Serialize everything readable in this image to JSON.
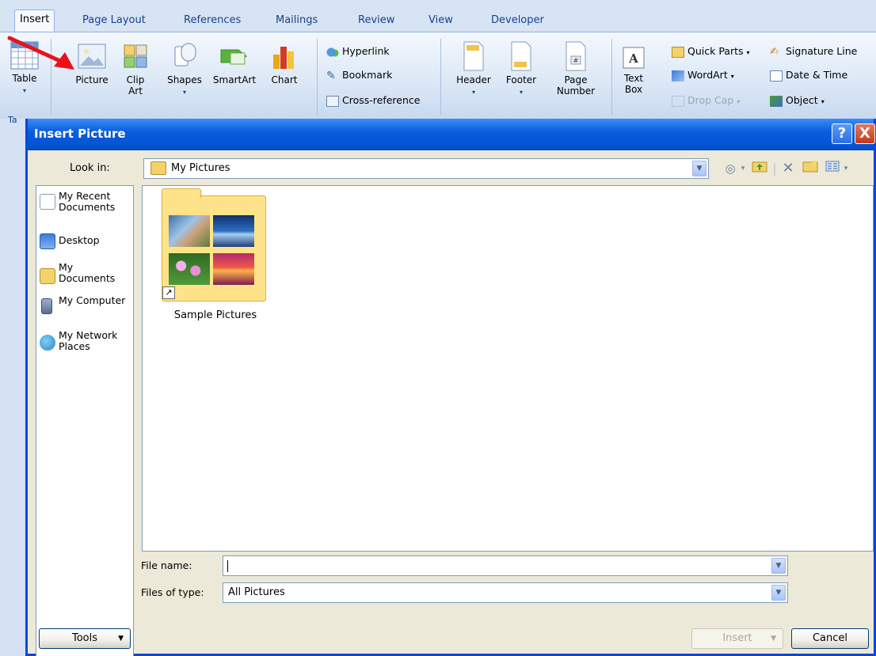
{
  "ribbon": {
    "tabs": [
      "Insert",
      "Page Layout",
      "References",
      "Mailings",
      "Review",
      "View",
      "Developer"
    ],
    "tables_button": "Table",
    "group_label": "Ta",
    "illustrations": [
      "Picture",
      "Clip\nArt",
      "Shapes",
      "SmartArt",
      "Chart"
    ],
    "links": [
      "Hyperlink",
      "Bookmark",
      "Cross-reference"
    ],
    "header_footer": [
      "Header",
      "Footer",
      "Page\nNumber"
    ],
    "text_box": "Text\nBox",
    "text_items": [
      "Quick Parts",
      "WordArt",
      "Drop Cap"
    ],
    "text_items_right": [
      "Signature Line",
      "Date & Time",
      "Object"
    ]
  },
  "dialog": {
    "title": "Insert Picture",
    "help_glyph": "?",
    "close_glyph": "X",
    "look_in_label": "Look in:",
    "look_in_value": "My Pictures",
    "places": [
      "My Recent Documents",
      "Desktop",
      "My Documents",
      "My Computer",
      "My Network Places"
    ],
    "files": [
      {
        "name": "Sample Pictures",
        "type": "folder"
      }
    ],
    "file_name_label": "File name:",
    "file_name_value": "",
    "files_of_type_label": "Files of type:",
    "files_of_type_value": "All Pictures",
    "tools_button": "Tools",
    "insert_button": "Insert",
    "cancel_button": "Cancel"
  },
  "colors": {
    "titlebar": "#0a5ee0",
    "ribbon_text": "#15428b",
    "annotation_arrow": "#e8121a"
  },
  "icons": [
    "table-icon",
    "picture-icon",
    "clip-art-icon",
    "shapes-icon",
    "smartart-icon",
    "chart-icon",
    "hyperlink-icon",
    "bookmark-icon",
    "cross-reference-icon",
    "header-icon",
    "footer-icon",
    "page-number-icon",
    "text-box-icon",
    "quick-parts-icon",
    "wordart-icon",
    "drop-cap-icon",
    "signature-line-icon",
    "date-time-icon",
    "object-icon",
    "folder-icon",
    "back-icon",
    "up-folder-icon",
    "delete-icon",
    "new-folder-icon",
    "views-icon"
  ]
}
